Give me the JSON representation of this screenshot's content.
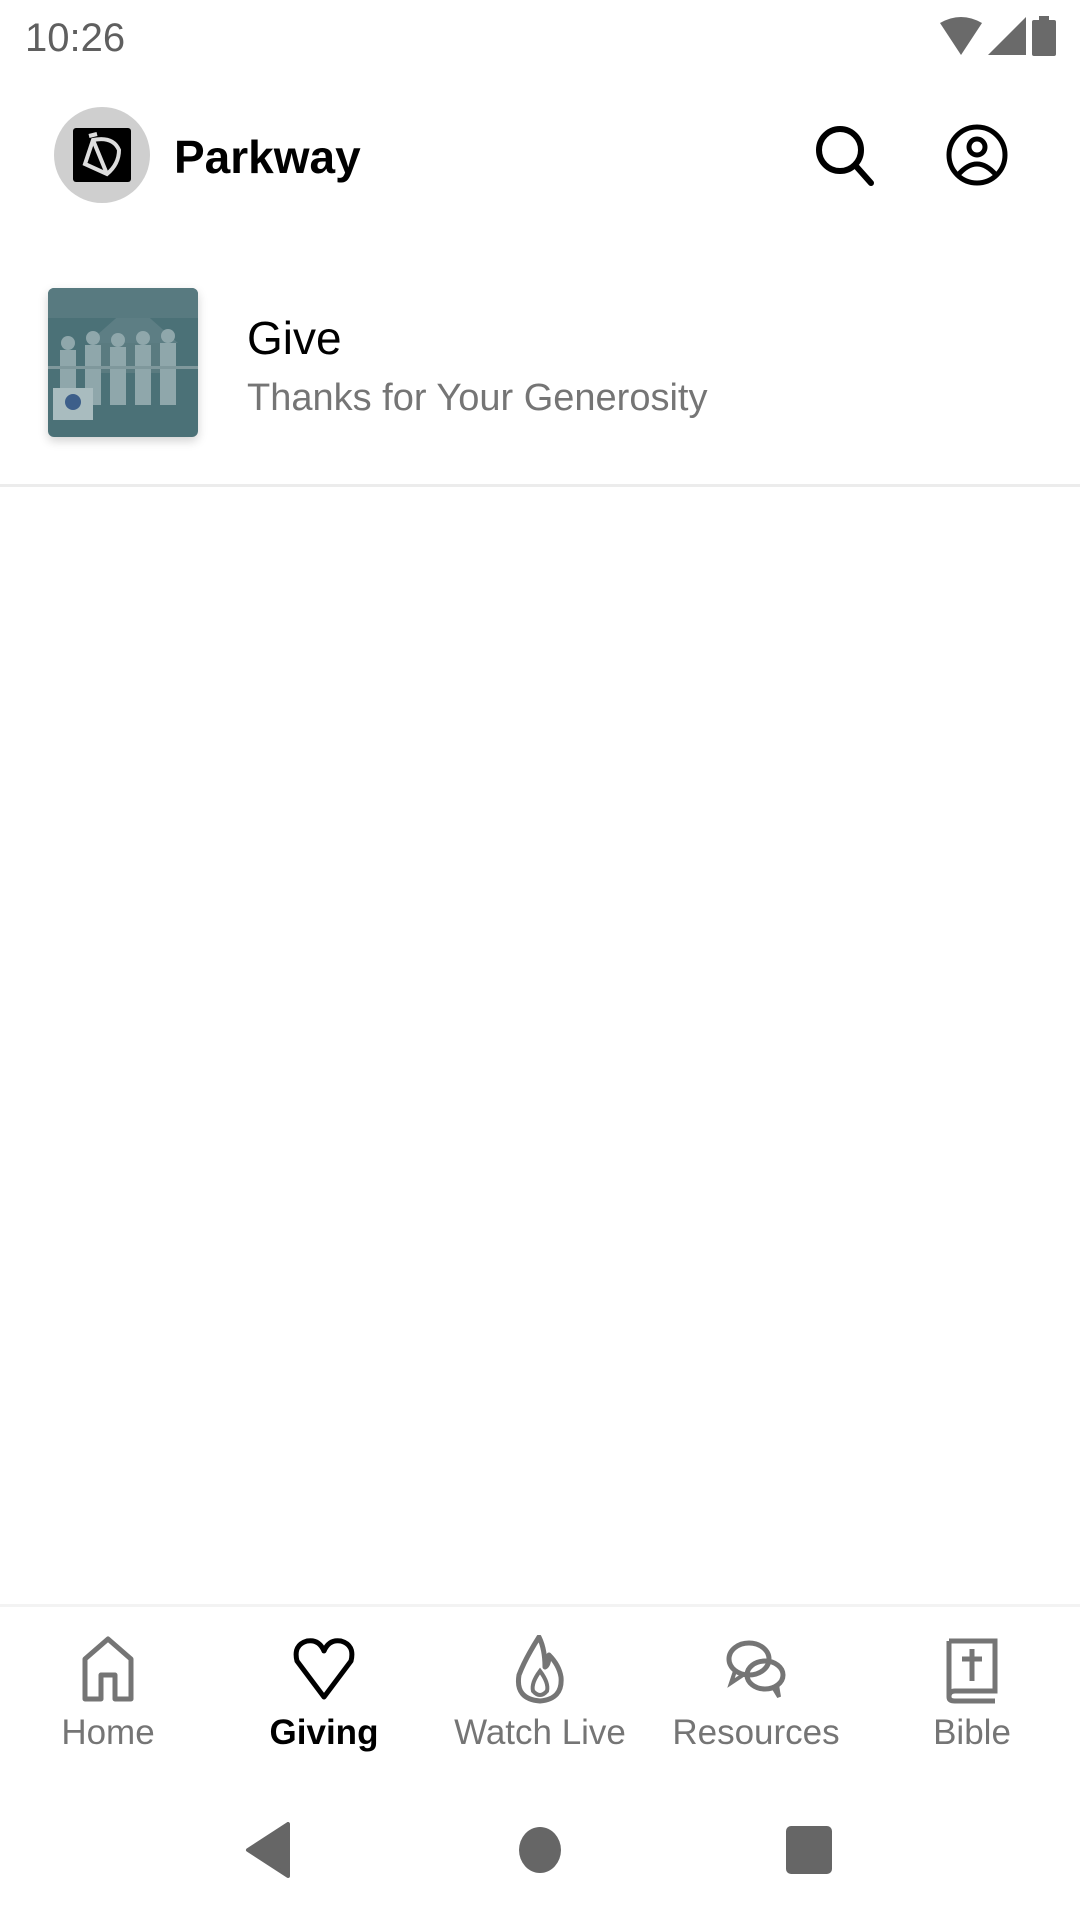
{
  "status_bar": {
    "time": "10:26",
    "icons": [
      "wifi-icon",
      "cellular-signal-icon",
      "battery-icon"
    ]
  },
  "header": {
    "title": "Parkway",
    "logo_icon": "church-logo-icon",
    "actions": [
      {
        "name": "search",
        "icon": "search-icon"
      },
      {
        "name": "profile",
        "icon": "account-circle-icon"
      }
    ]
  },
  "content": {
    "items": [
      {
        "title": "Give",
        "subtitle": "Thanks for Your Generosity",
        "thumbnail": "group-photo-thumbnail"
      }
    ]
  },
  "bottom_nav": {
    "active": "Giving",
    "tabs": [
      {
        "label": "Home",
        "icon": "home-icon"
      },
      {
        "label": "Giving",
        "icon": "heart-icon"
      },
      {
        "label": "Watch Live",
        "icon": "flame-icon"
      },
      {
        "label": "Resources",
        "icon": "chat-bubbles-icon"
      },
      {
        "label": "Bible",
        "icon": "bible-icon"
      }
    ]
  },
  "system_nav": {
    "buttons": [
      "back",
      "home",
      "recents"
    ]
  },
  "colors": {
    "active_tab": "#000000",
    "inactive_tab": "#757575",
    "subtitle": "#757575",
    "thumbnail_overlay": "#3f6b73"
  }
}
